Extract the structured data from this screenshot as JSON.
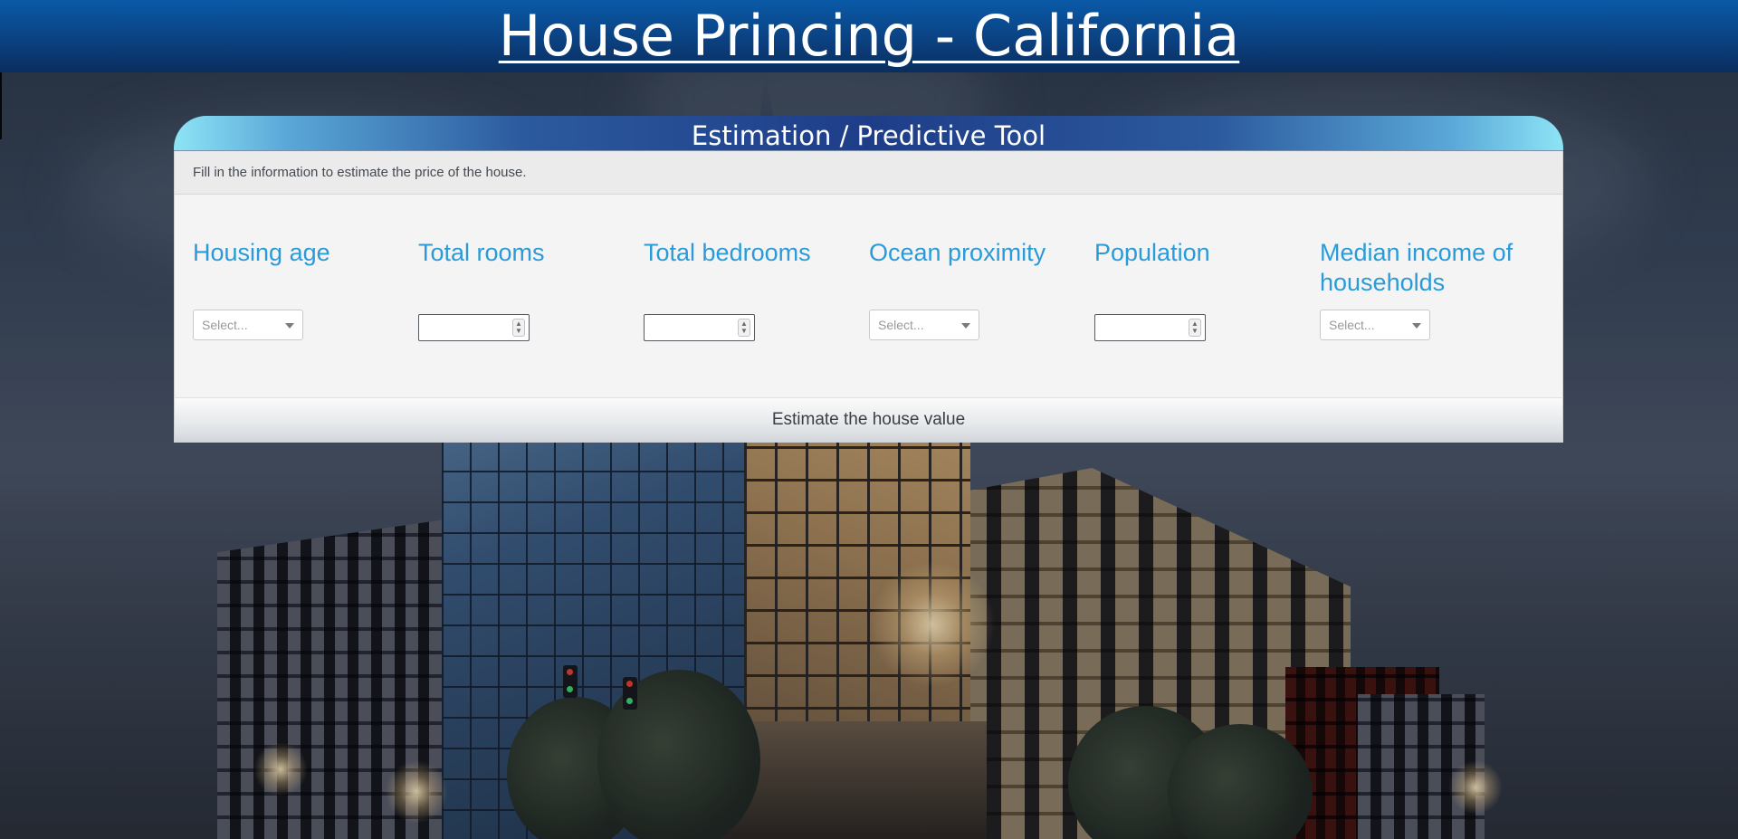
{
  "header": {
    "title": "House Princing - California"
  },
  "tool": {
    "title": "Estimation / Predictive Tool",
    "instructions": "Fill in the information to estimate the price of the house.",
    "submit_label": "Estimate the house value"
  },
  "fields": [
    {
      "label": "Housing age",
      "type": "select",
      "placeholder": "Select..."
    },
    {
      "label": "Total rooms",
      "type": "number",
      "value": ""
    },
    {
      "label": "Total bedrooms",
      "type": "number",
      "value": ""
    },
    {
      "label": "Ocean proximity",
      "type": "select",
      "placeholder": "Select..."
    },
    {
      "label": "Population",
      "type": "number",
      "value": ""
    },
    {
      "label": "Median income of households",
      "type": "select",
      "placeholder": "Select..."
    }
  ],
  "colors": {
    "header_bar": "#0b3f7d",
    "field_label": "#2a9bd8",
    "card_title_gradient_center": "#1e3d88",
    "card_title_gradient_edge": "#8ee4f5"
  },
  "icons": {
    "select_caret": "caret-down-icon",
    "number_spinner": "spinner-arrows-icon"
  }
}
